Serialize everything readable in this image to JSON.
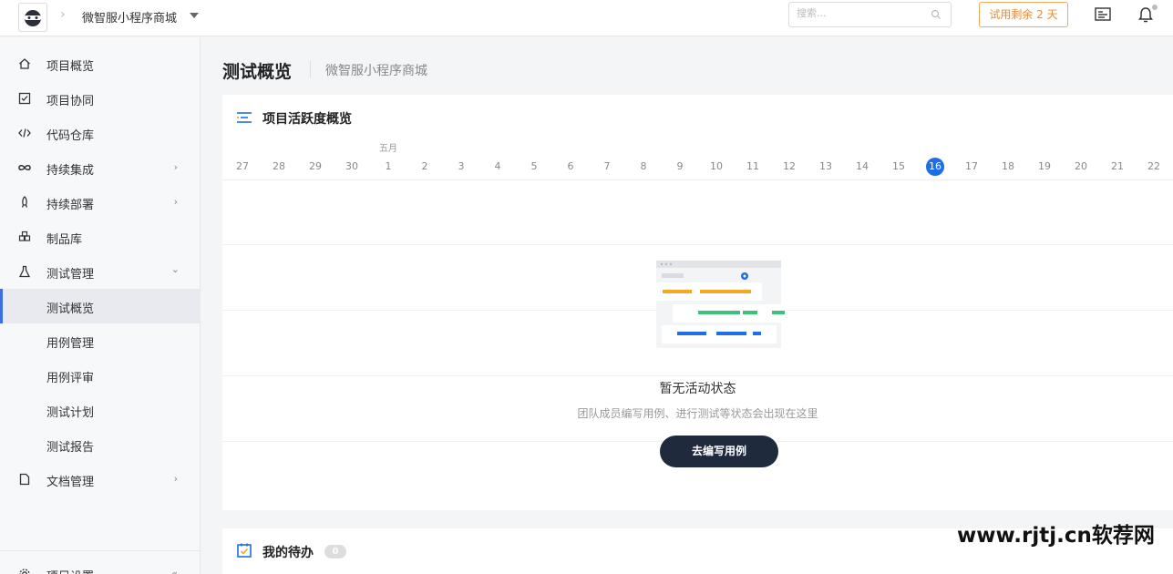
{
  "header": {
    "project_name": "微智服小程序商城",
    "search_placeholder": "搜索...",
    "trial_text": "试用剩余 2 天"
  },
  "sidebar": {
    "items": [
      {
        "label": "项目概览",
        "icon": "home-icon"
      },
      {
        "label": "项目协同",
        "icon": "checkbox-icon"
      },
      {
        "label": "代码仓库",
        "icon": "code-icon"
      },
      {
        "label": "持续集成",
        "icon": "infinity-icon"
      },
      {
        "label": "持续部署",
        "icon": "rocket-icon"
      },
      {
        "label": "制品库",
        "icon": "package-icon"
      },
      {
        "label": "测试管理",
        "icon": "flask-icon"
      },
      {
        "label": "测试概览"
      },
      {
        "label": "用例管理"
      },
      {
        "label": "用例评审"
      },
      {
        "label": "测试计划"
      },
      {
        "label": "测试报告"
      },
      {
        "label": "文档管理",
        "icon": "document-icon"
      }
    ],
    "settings_label": "项目设置"
  },
  "page": {
    "title": "测试概览",
    "subtitle": "微智服小程序商城"
  },
  "activity": {
    "title": "项目活跃度概览",
    "month_label": "五月",
    "days": [
      "27",
      "28",
      "29",
      "30",
      "1",
      "2",
      "3",
      "4",
      "5",
      "6",
      "7",
      "8",
      "9",
      "10",
      "11",
      "12",
      "13",
      "14",
      "15",
      "16",
      "17",
      "18",
      "19",
      "20",
      "21",
      "22"
    ],
    "today": "16",
    "empty_title": "暂无活动状态",
    "empty_desc": "团队成员编写用例、进行测试等状态会出现在这里",
    "cta_label": "去编写用例"
  },
  "todo": {
    "title": "我的待办",
    "count": "0"
  },
  "watermark": "www.rjtj.cn软荐网",
  "colors": {
    "accent": "#1e6ee8",
    "trial": "#f08a2c",
    "cta_bg": "#1f2a3d"
  }
}
